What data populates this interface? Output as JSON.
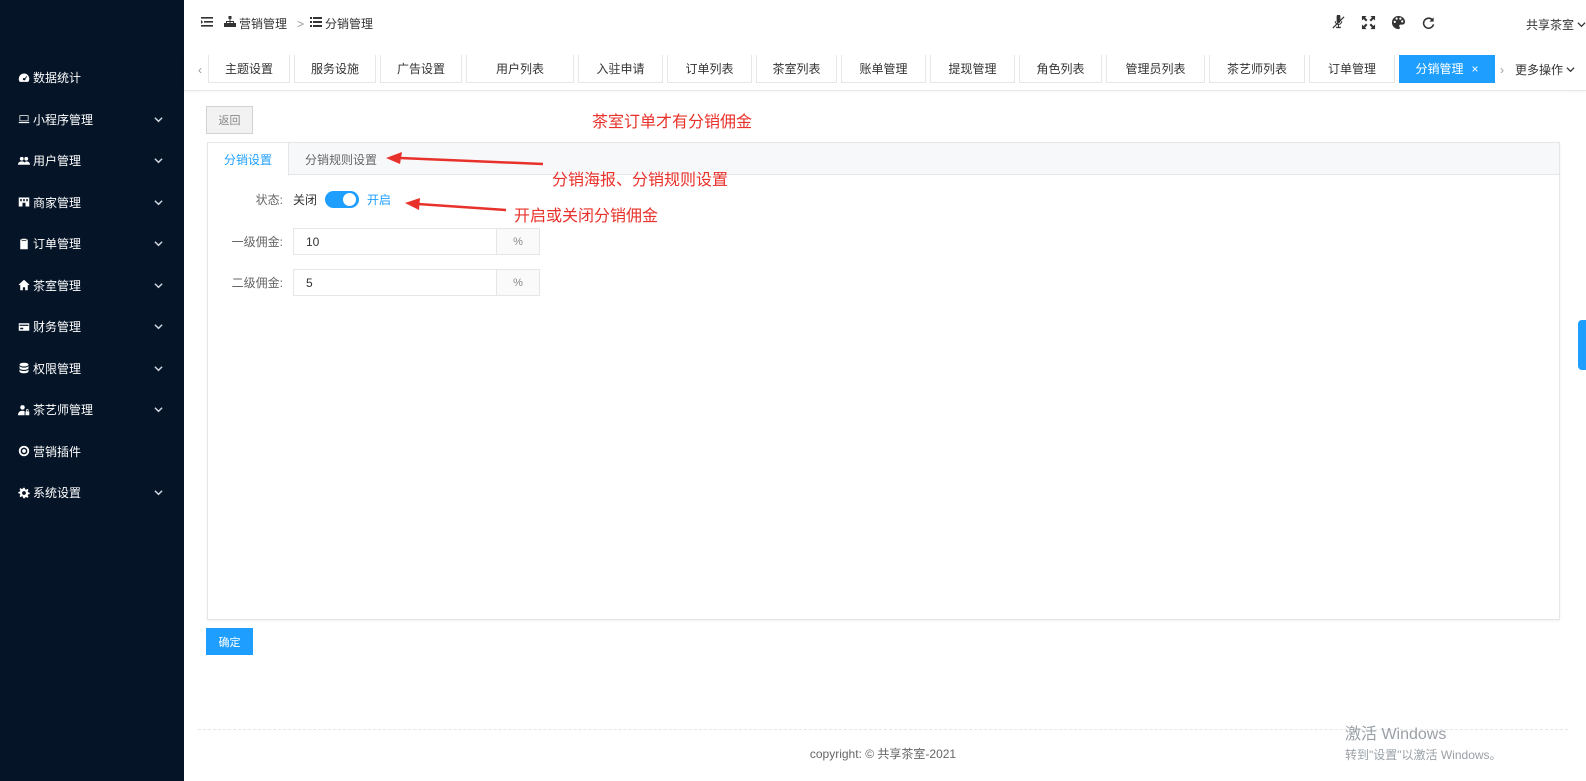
{
  "sidebar": {
    "items": [
      {
        "label": "数据统计",
        "icon": "dashboard-icon",
        "has_arrow": false
      },
      {
        "label": "小程序管理",
        "icon": "monitor-icon",
        "has_arrow": true
      },
      {
        "label": "用户管理",
        "icon": "users-icon",
        "has_arrow": true
      },
      {
        "label": "商家管理",
        "icon": "shop-icon",
        "has_arrow": true
      },
      {
        "label": "订单管理",
        "icon": "clipboard-icon",
        "has_arrow": true
      },
      {
        "label": "茶室管理",
        "icon": "home-icon",
        "has_arrow": true
      },
      {
        "label": "财务管理",
        "icon": "card-icon",
        "has_arrow": true
      },
      {
        "label": "权限管理",
        "icon": "database-icon",
        "has_arrow": true
      },
      {
        "label": "茶艺师管理",
        "icon": "user-lock-icon",
        "has_arrow": true
      },
      {
        "label": "营销插件",
        "icon": "plugin-icon",
        "has_arrow": false
      },
      {
        "label": "系统设置",
        "icon": "gear-icon",
        "has_arrow": true
      }
    ]
  },
  "header": {
    "breadcrumb": {
      "first": "营销管理",
      "separator": ">",
      "second": "分销管理"
    },
    "user_name": "共享茶室"
  },
  "tabs": {
    "items": [
      "主题设置",
      "服务设施",
      "广告设置",
      "用户列表",
      "入驻申请",
      "订单列表",
      "茶室列表",
      "账单管理",
      "提现管理",
      "角色列表",
      "管理员列表",
      "茶艺师列表",
      "订单管理",
      "分销管理"
    ],
    "active_index": 13,
    "close_glyph": "×",
    "left_glyph": "‹",
    "right_glyph": "›",
    "more_label": "更多操作"
  },
  "page": {
    "back_label": "返回",
    "panel_tabs": [
      "分销设置",
      "分销规则设置"
    ],
    "status_label": "状态:",
    "switch_off": "关闭",
    "switch_on": "开启",
    "switch_state": "on",
    "level1_label": "一级佣金:",
    "level1_value": "10",
    "level2_label": "二级佣金:",
    "level2_value": "5",
    "unit": "%",
    "confirm_label": "确定"
  },
  "annotations": {
    "top": "茶室订单才有分销佣金",
    "tabs": "分销海报、分销规则设置",
    "switch": "开启或关闭分销佣金",
    "color": "#e8312a"
  },
  "footer": {
    "text": "copyright: © 共享茶室-2021"
  },
  "watermark": {
    "line1": "激活 Windows",
    "line2": "转到\"设置\"以激活 Windows。"
  },
  "colors": {
    "sidebar_bg": "#051427",
    "accent": "#1e9fff"
  }
}
